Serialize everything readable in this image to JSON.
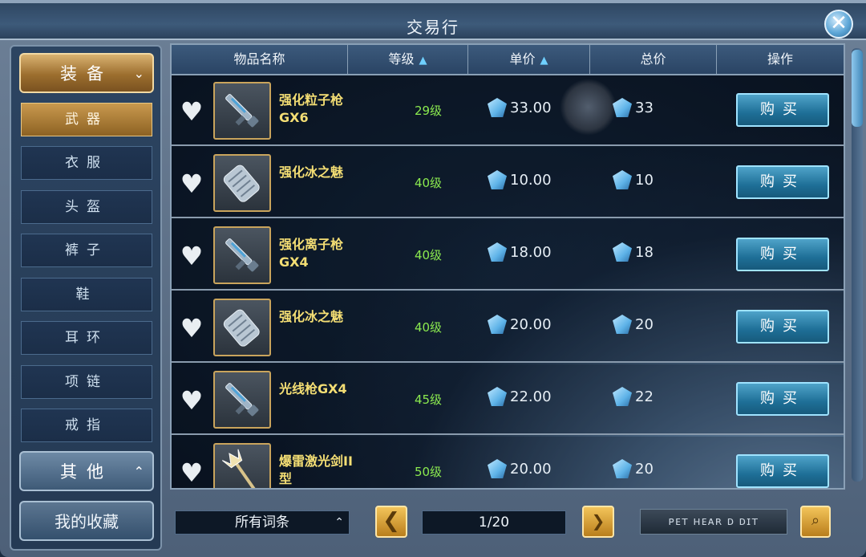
{
  "window": {
    "title": "交易行",
    "close_label": "✕"
  },
  "sidebar": {
    "category_equip": {
      "label": "装备",
      "chevron": "⌄"
    },
    "sub_items": [
      {
        "label": "武器",
        "active": true
      },
      {
        "label": "衣服",
        "active": false
      },
      {
        "label": "头盔",
        "active": false
      },
      {
        "label": "裤子",
        "active": false
      },
      {
        "label": "鞋",
        "active": false
      },
      {
        "label": "耳环",
        "active": false
      },
      {
        "label": "项链",
        "active": false
      },
      {
        "label": "戒指",
        "active": false
      }
    ],
    "category_other": {
      "label": "其他",
      "chevron": "⌃"
    },
    "favorites_label": "我的收藏"
  },
  "table": {
    "headers": {
      "name": "物品名称",
      "level": "等级",
      "unit_price": "单价",
      "total_price": "总价",
      "action": "操作"
    },
    "sort_arrow": "▲",
    "rows": [
      {
        "name": "强化粒子枪GX6",
        "level": "29级",
        "unit_price": "33.00",
        "total_price": "33",
        "weapon": "gun",
        "buy_label": "购买"
      },
      {
        "name": "强化冰之魅",
        "level": "40级",
        "unit_price": "10.00",
        "total_price": "10",
        "weapon": "gauntlet",
        "buy_label": "购买"
      },
      {
        "name": "强化离子枪GX4",
        "level": "40级",
        "unit_price": "18.00",
        "total_price": "18",
        "weapon": "gun",
        "buy_label": "购买"
      },
      {
        "name": "强化冰之魅",
        "level": "40级",
        "unit_price": "20.00",
        "total_price": "20",
        "weapon": "gauntlet",
        "buy_label": "购买"
      },
      {
        "name": "光线枪GX4",
        "level": "45级",
        "unit_price": "22.00",
        "total_price": "22",
        "weapon": "gun",
        "buy_label": "购买"
      },
      {
        "name": "爆雷激光剑II型",
        "level": "50级",
        "unit_price": "20.00",
        "total_price": "20",
        "weapon": "trident",
        "buy_label": "购买"
      }
    ]
  },
  "footer": {
    "filter_value": "所有词条",
    "filter_chevron": "⌃",
    "prev_label": "❮",
    "page": "1/20",
    "search_text": "ᴘᴇᴛ ʜᴇᴀʀ ᴅ ᴅɪᴛ"
  },
  "icons": {
    "heart": "♥",
    "currency": "gem-icon"
  },
  "colors": {
    "level_green": "#8bea4f",
    "name_gold": "#f4de74",
    "accent_gold": "#c9994e",
    "button_blue": "#1e6f97"
  }
}
